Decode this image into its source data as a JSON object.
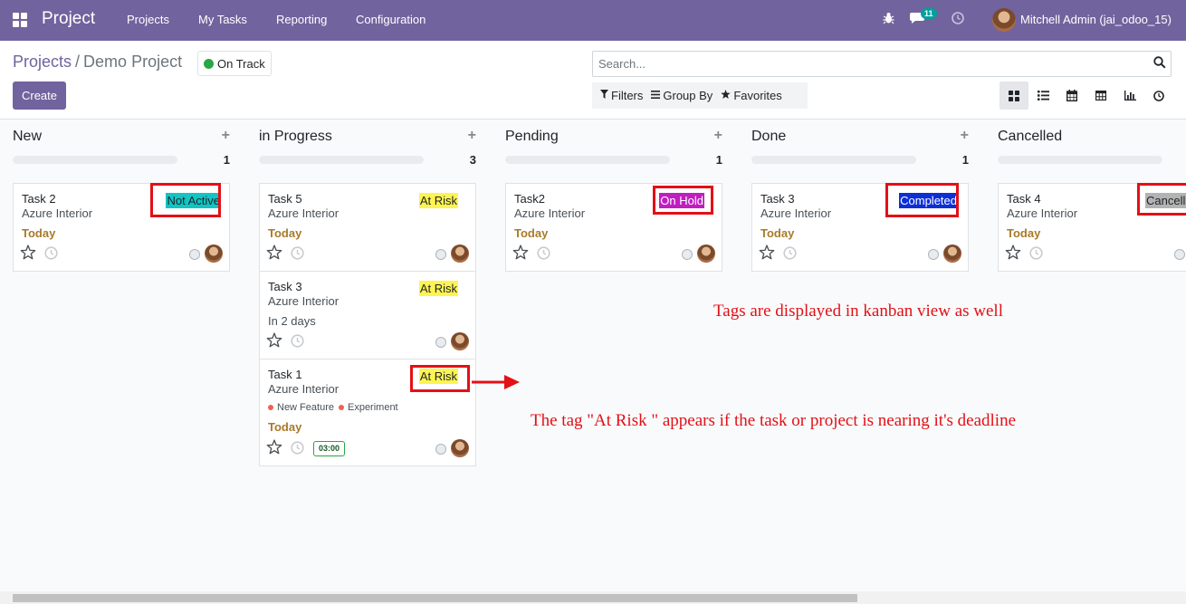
{
  "nav": {
    "brand": "Project",
    "menus": [
      "Projects",
      "My Tasks",
      "Reporting",
      "Configuration"
    ],
    "message_count": "11",
    "user": "Mitchell Admin (jai_odoo_15)"
  },
  "breadcrumb": {
    "root": "Projects",
    "separator": "/",
    "current": "Demo Project"
  },
  "status": {
    "label": "On Track",
    "color": "#28a745"
  },
  "create_label": "Create",
  "search": {
    "placeholder": "Search..."
  },
  "filters": {
    "filters": "Filters",
    "group_by": "Group By",
    "favorites": "Favorites"
  },
  "views": [
    "kanban-icon",
    "list-icon",
    "calendar-icon",
    "pivot-icon",
    "graph-icon",
    "activity-icon"
  ],
  "columns": [
    {
      "title": "New",
      "count": "1",
      "cards": [
        {
          "name": "Task 2",
          "customer": "Azure Interior",
          "tag": "Not Active",
          "tag_bg": "#11c5c5",
          "tag_color": "#212529",
          "deadline": "Today"
        }
      ]
    },
    {
      "title": "in Progress",
      "count": "3",
      "cards": [
        {
          "name": "Task 5",
          "customer": "Azure Interior",
          "tag": "At Risk",
          "tag_bg": "#fdf451",
          "tag_color": "#212529",
          "deadline": "Today"
        },
        {
          "name": "Task 3",
          "customer": "Azure Interior",
          "tag": "At Risk",
          "tag_bg": "#fdf451",
          "tag_color": "#212529",
          "deadline": "In 2 days"
        },
        {
          "name": "Task 1",
          "customer": "Azure Interior",
          "tag": "At Risk",
          "tag_bg": "#fdf451",
          "tag_color": "#212529",
          "deadline": "Today",
          "labels": [
            "New Feature",
            "Experiment"
          ],
          "time": "03:00"
        }
      ]
    },
    {
      "title": "Pending",
      "count": "1",
      "cards": [
        {
          "name": "Task2",
          "customer": "Azure Interior",
          "tag": "On Hold",
          "tag_bg": "#c01ec0",
          "tag_color": "#ffffff",
          "deadline": "Today"
        }
      ]
    },
    {
      "title": "Done",
      "count": "1",
      "cards": [
        {
          "name": "Task 3",
          "customer": "Azure Interior",
          "tag": "Completed",
          "tag_bg": "#0c2fd6",
          "tag_color": "#ffffff",
          "deadline": "Today"
        }
      ]
    },
    {
      "title": "Cancelled",
      "count": "",
      "cards": [
        {
          "name": "Task 4",
          "customer": "Azure Interior",
          "tag": "Cancelle",
          "tag_bg": "#b3b3b3",
          "tag_color": "#212529",
          "deadline": "Today"
        }
      ]
    }
  ],
  "label_colors": {
    "new_feature": "#f06050",
    "experiment": "#f06050"
  },
  "annotations": {
    "kanban_note": "Tags are displayed in kanban view as well",
    "risk_note": "The tag \"At Risk \" appears if the task or project is nearing it's deadline"
  }
}
